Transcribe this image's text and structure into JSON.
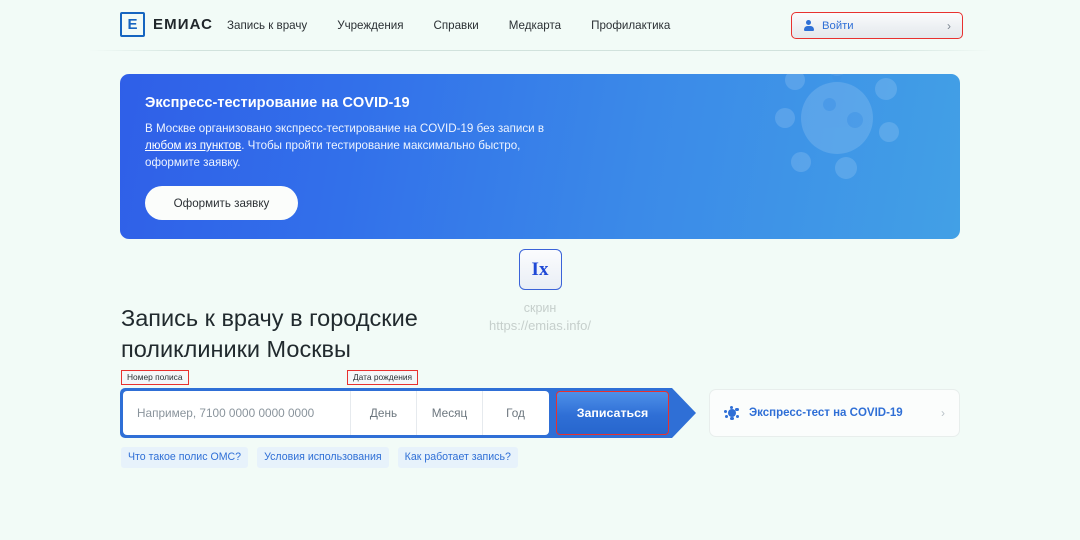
{
  "header": {
    "logo_letter": "Е",
    "logo_text": "ЕМИАС",
    "nav": [
      {
        "label": "Запись к врачу"
      },
      {
        "label": "Учреждения"
      },
      {
        "label": "Справки"
      },
      {
        "label": "Медкарта"
      },
      {
        "label": "Профилактика"
      }
    ],
    "login": {
      "label": "Войти",
      "chevron": "›",
      "icon": "user-icon",
      "highlight_color": "#e8312f"
    }
  },
  "banner": {
    "title": "Экспресс-тестирование на COVID-19",
    "text_part1": "В Москве организовано экспресс-тестирование на COVID-19 без записи в ",
    "link": "любом из пунктов",
    "text_part2": ". Чтобы пройти тестирование максимально быстро, оформите заявку.",
    "button_label": "Оформить заявку",
    "gradient_from": "#2f5fe8",
    "gradient_to": "#42a0e6"
  },
  "watermark": {
    "badge": "Ix",
    "line1": "скрин",
    "line2": "https://emias.info/"
  },
  "main": {
    "heading": "Запись к врачу в городские поликлиники Москвы"
  },
  "form": {
    "annotation_policy": "Номер полиса",
    "annotation_birth": "Дата рождения",
    "policy_placeholder": "Например, 7100 0000 0000 0000",
    "policy_value": "",
    "day_label": "День",
    "month_label": "Месяц",
    "year_label": "Год",
    "submit_label": "Записаться",
    "accent_color": "#2f6fd6",
    "annotation_color": "#e8312f"
  },
  "covid_card": {
    "icon": "virus-icon",
    "label": "Экспресс-тест на COVID-19",
    "chevron": "›"
  },
  "chips": [
    {
      "label": "Что такое полис ОМС?"
    },
    {
      "label": "Условия использования"
    },
    {
      "label": "Как работает запись?"
    }
  ]
}
